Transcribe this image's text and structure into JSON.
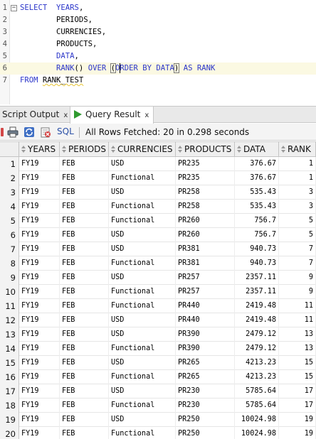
{
  "editor": {
    "lines": [
      {
        "n": "1",
        "parts": [
          [
            "kw",
            "SELECT"
          ],
          [
            "plain",
            "  "
          ],
          [
            "kw",
            "YEARS"
          ],
          [
            "plain",
            ","
          ]
        ]
      },
      {
        "n": "2",
        "parts": [
          [
            "plain",
            "        PERIODS,"
          ]
        ]
      },
      {
        "n": "3",
        "parts": [
          [
            "plain",
            "        CURRENCIES,"
          ]
        ]
      },
      {
        "n": "4",
        "parts": [
          [
            "plain",
            "        PRODUCTS,"
          ]
        ]
      },
      {
        "n": "5",
        "parts": [
          [
            "plain",
            "        "
          ],
          [
            "kw",
            "DATA"
          ],
          [
            "plain",
            ","
          ]
        ]
      },
      {
        "n": "6",
        "parts": [
          [
            "plain",
            "        "
          ],
          [
            "kw",
            "RANK"
          ],
          [
            "plain",
            "() "
          ],
          [
            "kw",
            "OVER"
          ],
          [
            "plain",
            " "
          ],
          [
            "paren",
            "("
          ],
          [
            "kw",
            "ORDER BY DATA"
          ],
          [
            "paren",
            ")"
          ],
          [
            "plain",
            " "
          ],
          [
            "kw",
            "AS RANK"
          ]
        ]
      },
      {
        "n": "7",
        "parts": [
          [
            "kw",
            "FROM"
          ],
          [
            "plain",
            " "
          ],
          [
            "squig",
            "RANK_TEST"
          ]
        ]
      }
    ]
  },
  "tabs": {
    "script_output": "Script Output",
    "query_result": "Query Result",
    "close": "x"
  },
  "toolbar": {
    "sql_label": "SQL",
    "status": "All Rows Fetched: 20 in 0.298 seconds",
    "icons": [
      "pin-icon",
      "print-icon",
      "refresh-icon",
      "export-icon"
    ]
  },
  "grid": {
    "columns": [
      "YEARS",
      "PERIODS",
      "CURRENCIES",
      "PRODUCTS",
      "DATA",
      "RANK"
    ],
    "rows": [
      [
        "1",
        "FY19",
        "FEB",
        "USD",
        "PR235",
        "376.67",
        "1"
      ],
      [
        "2",
        "FY19",
        "FEB",
        "Functional",
        "PR235",
        "376.67",
        "1"
      ],
      [
        "3",
        "FY19",
        "FEB",
        "USD",
        "PR258",
        "535.43",
        "3"
      ],
      [
        "4",
        "FY19",
        "FEB",
        "Functional",
        "PR258",
        "535.43",
        "3"
      ],
      [
        "5",
        "FY19",
        "FEB",
        "Functional",
        "PR260",
        "756.7",
        "5"
      ],
      [
        "6",
        "FY19",
        "FEB",
        "USD",
        "PR260",
        "756.7",
        "5"
      ],
      [
        "7",
        "FY19",
        "FEB",
        "USD",
        "PR381",
        "940.73",
        "7"
      ],
      [
        "8",
        "FY19",
        "FEB",
        "Functional",
        "PR381",
        "940.73",
        "7"
      ],
      [
        "9",
        "FY19",
        "FEB",
        "USD",
        "PR257",
        "2357.11",
        "9"
      ],
      [
        "10",
        "FY19",
        "FEB",
        "Functional",
        "PR257",
        "2357.11",
        "9"
      ],
      [
        "11",
        "FY19",
        "FEB",
        "Functional",
        "PR440",
        "2419.48",
        "11"
      ],
      [
        "12",
        "FY19",
        "FEB",
        "USD",
        "PR440",
        "2419.48",
        "11"
      ],
      [
        "13",
        "FY19",
        "FEB",
        "USD",
        "PR390",
        "2479.12",
        "13"
      ],
      [
        "14",
        "FY19",
        "FEB",
        "Functional",
        "PR390",
        "2479.12",
        "13"
      ],
      [
        "15",
        "FY19",
        "FEB",
        "USD",
        "PR265",
        "4213.23",
        "15"
      ],
      [
        "16",
        "FY19",
        "FEB",
        "Functional",
        "PR265",
        "4213.23",
        "15"
      ],
      [
        "17",
        "FY19",
        "FEB",
        "USD",
        "PR230",
        "5785.64",
        "17"
      ],
      [
        "18",
        "FY19",
        "FEB",
        "Functional",
        "PR230",
        "5785.64",
        "17"
      ],
      [
        "19",
        "FY19",
        "FEB",
        "USD",
        "PR250",
        "10024.98",
        "19"
      ],
      [
        "20",
        "FY19",
        "FEB",
        "Functional",
        "PR250",
        "10024.98",
        "19"
      ]
    ]
  },
  "colors": {
    "keyword": "#2b35c9",
    "current_line": "#fbf9e2",
    "play": "#2f9a2f",
    "sql_link": "#2a4fa6"
  }
}
